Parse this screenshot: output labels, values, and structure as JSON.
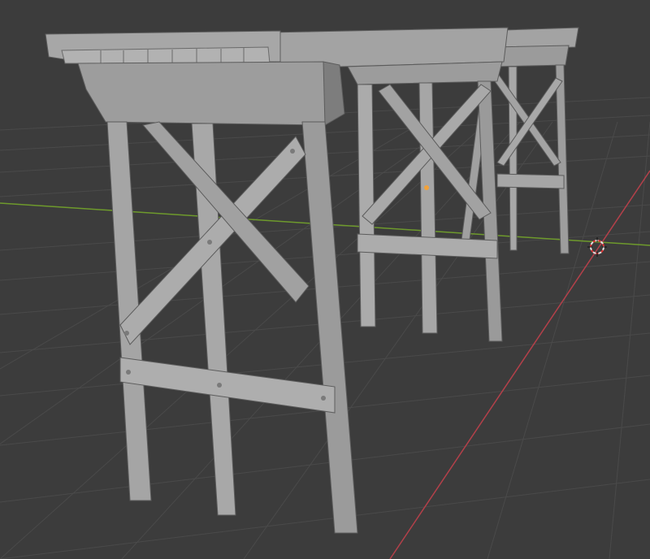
{
  "viewport": {
    "mode": "solid-shading",
    "background": "#3c3c3c",
    "grid_color": "#4a4a4a",
    "x_axis_color": "#b3404a",
    "y_axis_color": "#6e9a2c",
    "mesh_base_color": "#9b9b9b",
    "mesh_light_color": "#b4b4b4",
    "mesh_dark_color": "#6f6f6f",
    "origin_dot_color": "#f2a23a"
  },
  "scene_objects": [
    {
      "name": "trestle-support-front"
    },
    {
      "name": "trestle-support-middle"
    },
    {
      "name": "trestle-support-back"
    }
  ],
  "cursor": {
    "icon": "3d-cursor-icon"
  }
}
